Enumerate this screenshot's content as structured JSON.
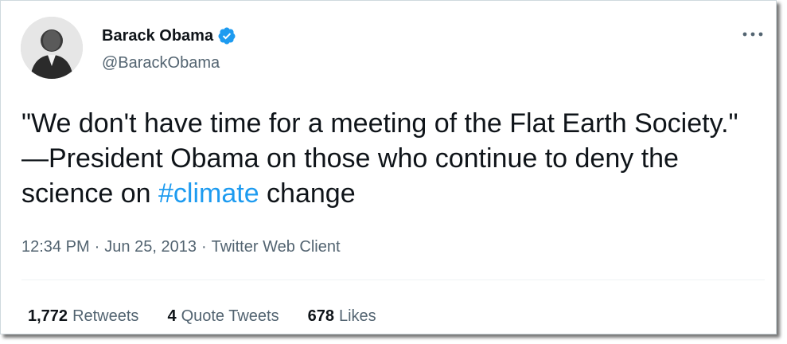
{
  "user": {
    "display_name": "Barack Obama",
    "handle": "@BarackObama",
    "verified": true,
    "avatar_icon": "user-avatar-photo"
  },
  "tweet": {
    "text_before": "\"We don't have time for a meeting of the Flat Earth Society.\" —President Obama on those who continue to deny the science on ",
    "hashtag": "#climate",
    "text_after": " change"
  },
  "meta": {
    "time": "12:34 PM",
    "separator": "·",
    "date": "Jun 25, 2013",
    "source": "Twitter Web Client"
  },
  "stats": {
    "retweets_count": "1,772",
    "retweets_label": "Retweets",
    "quotes_count": "4",
    "quotes_label": "Quote Tweets",
    "likes_count": "678",
    "likes_label": "Likes"
  },
  "colors": {
    "link": "#1d9bf0",
    "text": "#0f1419",
    "secondary": "#536471"
  }
}
